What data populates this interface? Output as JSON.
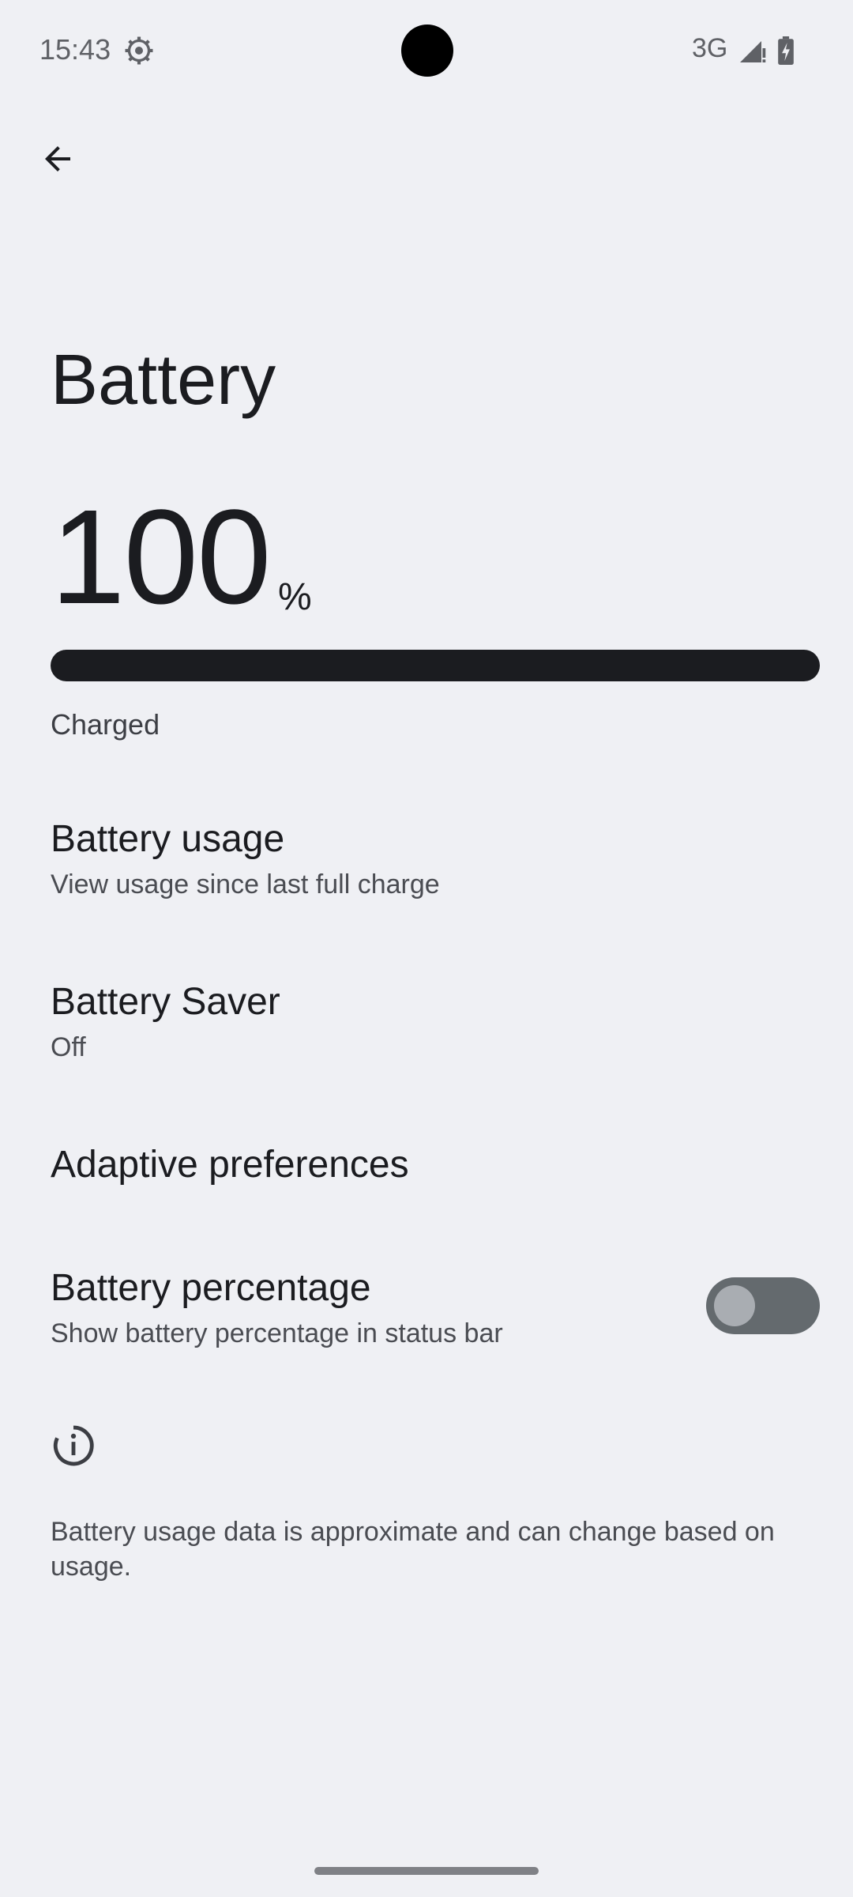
{
  "status_bar": {
    "time": "15:43",
    "network": "3G",
    "icons": [
      "gear-icon",
      "signal-icon",
      "battery-charging-icon"
    ]
  },
  "app_bar": {
    "back_icon": "arrow-left-icon"
  },
  "page": {
    "title": "Battery"
  },
  "battery": {
    "level": "100",
    "level_unit": "%",
    "level_fraction": 1.0,
    "status": "Charged"
  },
  "items": [
    {
      "title": "Battery usage",
      "subtitle": "View usage since last full charge"
    },
    {
      "title": "Battery Saver",
      "subtitle": "Off"
    },
    {
      "title": "Adaptive preferences"
    },
    {
      "title": "Battery percentage",
      "subtitle": "Show battery percentage in status bar",
      "toggle": "off"
    }
  ],
  "footer": {
    "icon": "info-icon",
    "text": "Battery usage data is approximate and can change based on usage."
  },
  "colors": {
    "background": "#eff0f4",
    "text": "#1b1c20",
    "toggle_track_off": "#646a6e"
  }
}
